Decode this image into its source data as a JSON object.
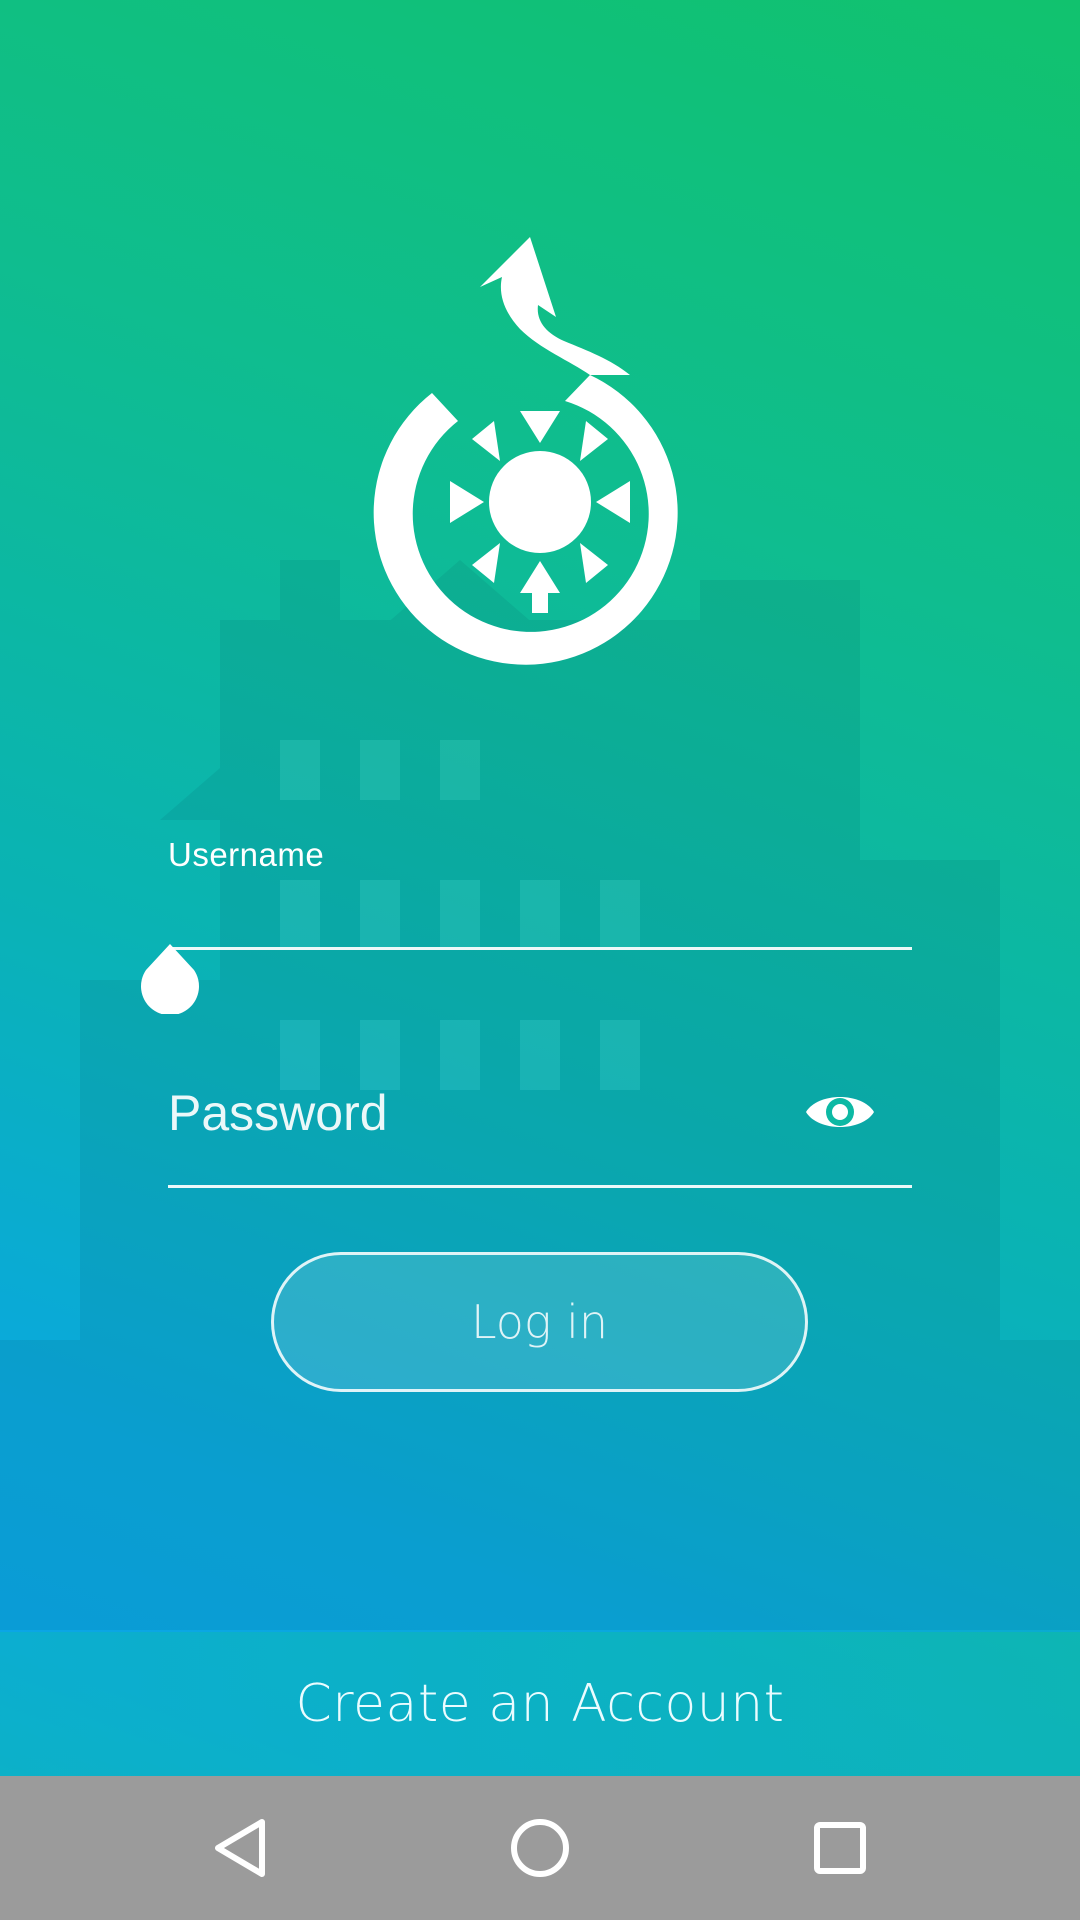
{
  "login_form": {
    "username_label": "Username",
    "username_value": "",
    "password_placeholder": "Password",
    "password_value": "",
    "show_password_icon": "eye-icon",
    "login_label": "Log in"
  },
  "footer": {
    "create_account_label": "Create an Account"
  },
  "nav_bar": {
    "back_icon": "back-triangle-icon",
    "home_icon": "home-circle-icon",
    "recents_icon": "recents-square-icon"
  },
  "colors": {
    "gradient_top": "#11c26e",
    "gradient_middle": "#0ab3b4",
    "gradient_bottom": "#0ba6e6",
    "foreground": "#ffffff",
    "nav_bar": "#9b9b9b"
  }
}
